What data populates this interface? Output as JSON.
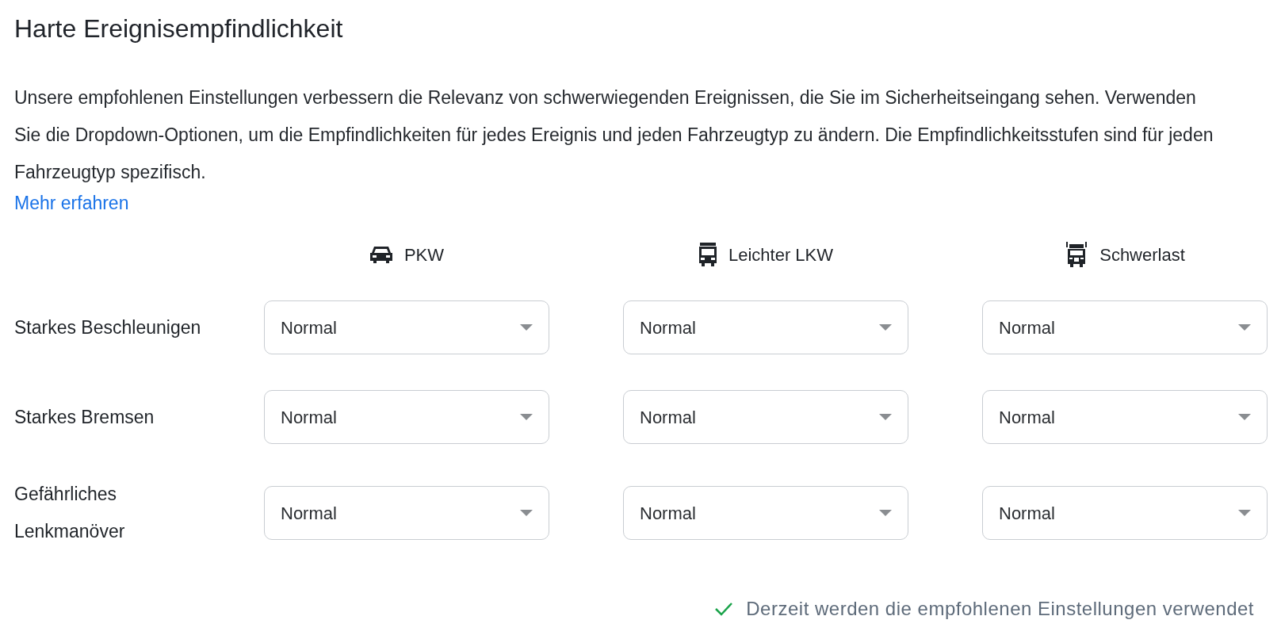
{
  "title": "Harte Ereignisempfindlichkeit",
  "description": "Unsere empfohlenen Einstellungen verbessern die Relevanz von schwerwiegenden Ereignissen, die Sie im Sicherheitseingang sehen. Verwenden Sie die Dropdown-Optionen, um die Empfindlichkeiten für jedes Ereignis und jeden Fahrzeugtyp zu ändern. Die Empfindlichkeitsstufen sind für jeden Fahrzeugtyp spezifisch.",
  "link": "Mehr erfahren",
  "columns": [
    {
      "label": "PKW",
      "kind": "car"
    },
    {
      "label": "Leichter LKW",
      "kind": "van"
    },
    {
      "label": "Schwerlast",
      "kind": "truck"
    }
  ],
  "rows": [
    {
      "label": "Starkes Beschleunigen",
      "values": [
        "Normal",
        "Normal",
        "Normal"
      ]
    },
    {
      "label": "Starkes Bremsen",
      "values": [
        "Normal",
        "Normal",
        "Normal"
      ]
    },
    {
      "label": "Gefährliches Lenkmanöver",
      "values": [
        "Normal",
        "Normal",
        "Normal"
      ]
    }
  ],
  "status": {
    "text": "Derzeit werden die empfohlenen Einstellungen verwendet",
    "ok": true
  }
}
